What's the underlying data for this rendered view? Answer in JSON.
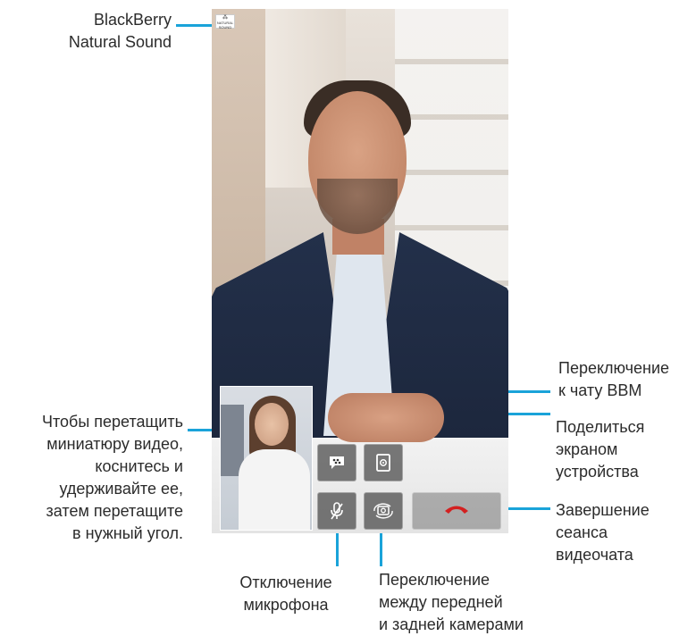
{
  "labels": {
    "natural_sound": "BlackBerry\nNatural Sound",
    "bbm_chat": "Переключение\nк чату BBM",
    "share_screen": "Поделиться\nэкраном\nустройства",
    "end_session": "Завершение\nсеанса\nвидеочата",
    "drag_thumbnail": "Чтобы перетащить\nминиатюру видео,\nкоснитесь и\nудерживайте ее,\nзатем перетащите\nв нужный угол.",
    "mute_mic": "Отключение\nмикрофона",
    "switch_camera": "Переключение\nмежду передней\nи задней камерами"
  },
  "screen": {
    "logo_text": "NATURAL SOUND"
  },
  "icons": {
    "logo": "blackberry-natural-sound-logo-icon",
    "bbm": "bbm-chat-icon",
    "share": "share-screen-icon",
    "mute": "microphone-mute-icon",
    "switch_camera": "camera-switch-icon",
    "end": "end-call-icon"
  },
  "colors": {
    "callout_line": "#1aa3d9",
    "end_call_icon": "#d32020"
  }
}
